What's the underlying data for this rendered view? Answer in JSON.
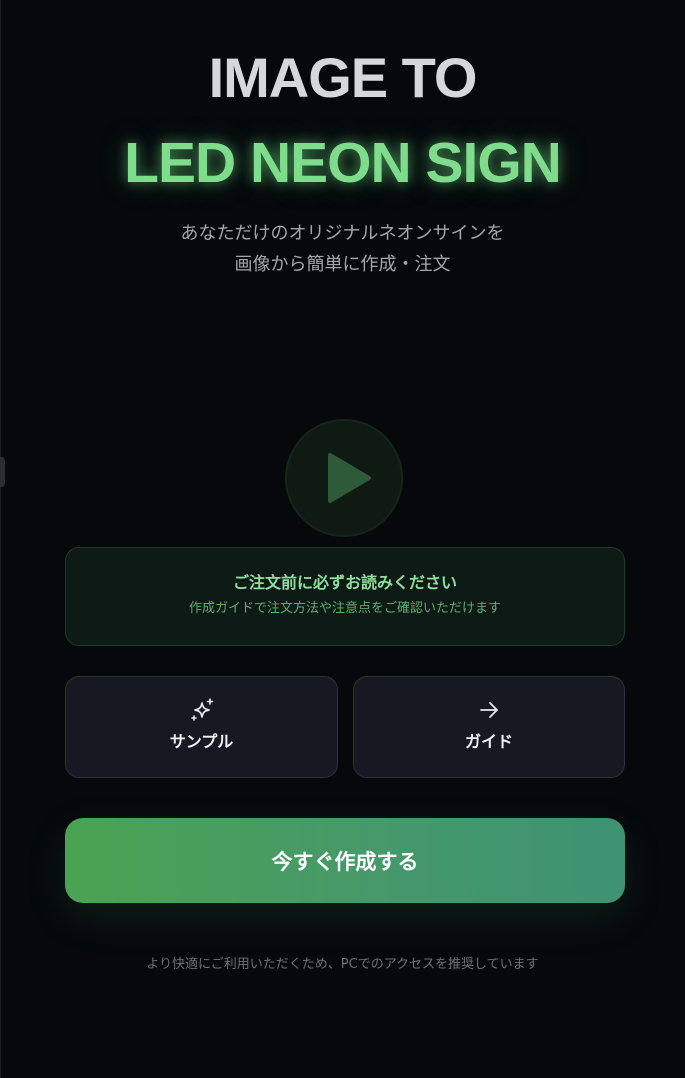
{
  "hero": {
    "title_line1": "IMAGE TO",
    "title_line2": "LED NEON SIGN",
    "subtitle_line1": "あなただけのオリジナルネオンサインを",
    "subtitle_line2": "画像から簡単に作成・注文"
  },
  "video": {
    "play_icon": "play-icon"
  },
  "notice": {
    "title": "ご注文前に必ずお読みください",
    "subtitle": "作成ガイドで注文方法や注意点をご確認いただけます"
  },
  "actions": [
    {
      "label": "サンプル",
      "icon": "sparkles-icon"
    },
    {
      "label": "ガイド",
      "icon": "arrow-right-icon"
    }
  ],
  "cta": {
    "label": "今すぐ作成する"
  },
  "footer": {
    "note": "より快適にご利用いただくため、PCでのアクセスを推奨しています"
  },
  "colors": {
    "background": "#06080c",
    "neon_green": "#7fdc8d",
    "cta_gradient_start": "#4aa352",
    "cta_gradient_end": "#3f9272"
  }
}
